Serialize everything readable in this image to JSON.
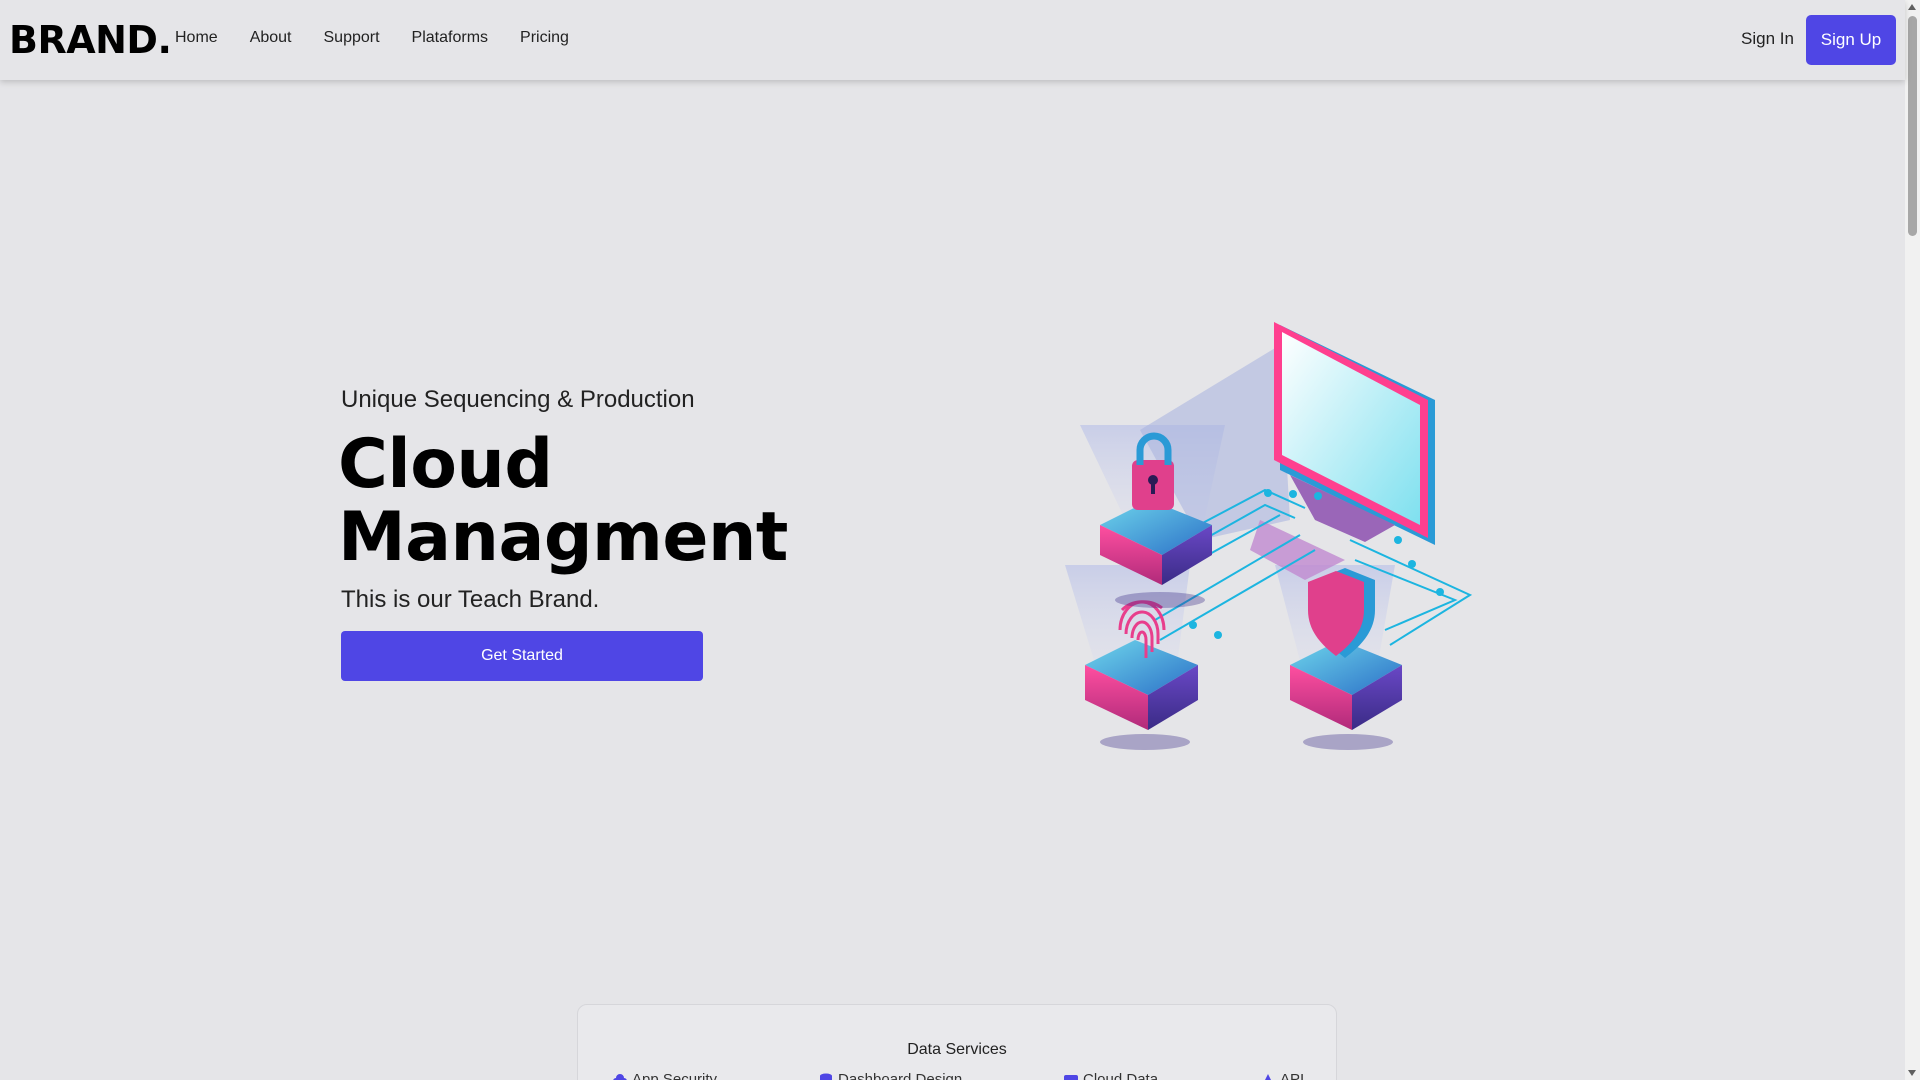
{
  "header": {
    "logo": "BRAND.",
    "nav": [
      "Home",
      "About",
      "Support",
      "Plataforms",
      "Pricing"
    ],
    "signin_label": "Sign In",
    "signup_label": "Sign Up"
  },
  "hero": {
    "subtitle": "Unique Sequencing & Production",
    "title_line1": "Cloud",
    "title_line2": "Managment",
    "tagline": "This is our Teach Brand.",
    "cta_label": "Get Started",
    "illustration": "cloud-security-isometric-illustration"
  },
  "services": {
    "title": "Data Services",
    "items": [
      {
        "label": "App Security",
        "icon": "cloud-lock-icon"
      },
      {
        "label": "Dashboard Design",
        "icon": "database-icon"
      },
      {
        "label": "Cloud Data",
        "icon": "server-icon"
      },
      {
        "label": "API",
        "icon": "triangle-icon"
      }
    ]
  },
  "colors": {
    "accent": "#4f46e5",
    "background": "#e5e5e8",
    "illustration_pink": "#e83e8c",
    "illustration_cyan": "#1cb5e0",
    "illustration_purple": "#5b3aa8"
  }
}
